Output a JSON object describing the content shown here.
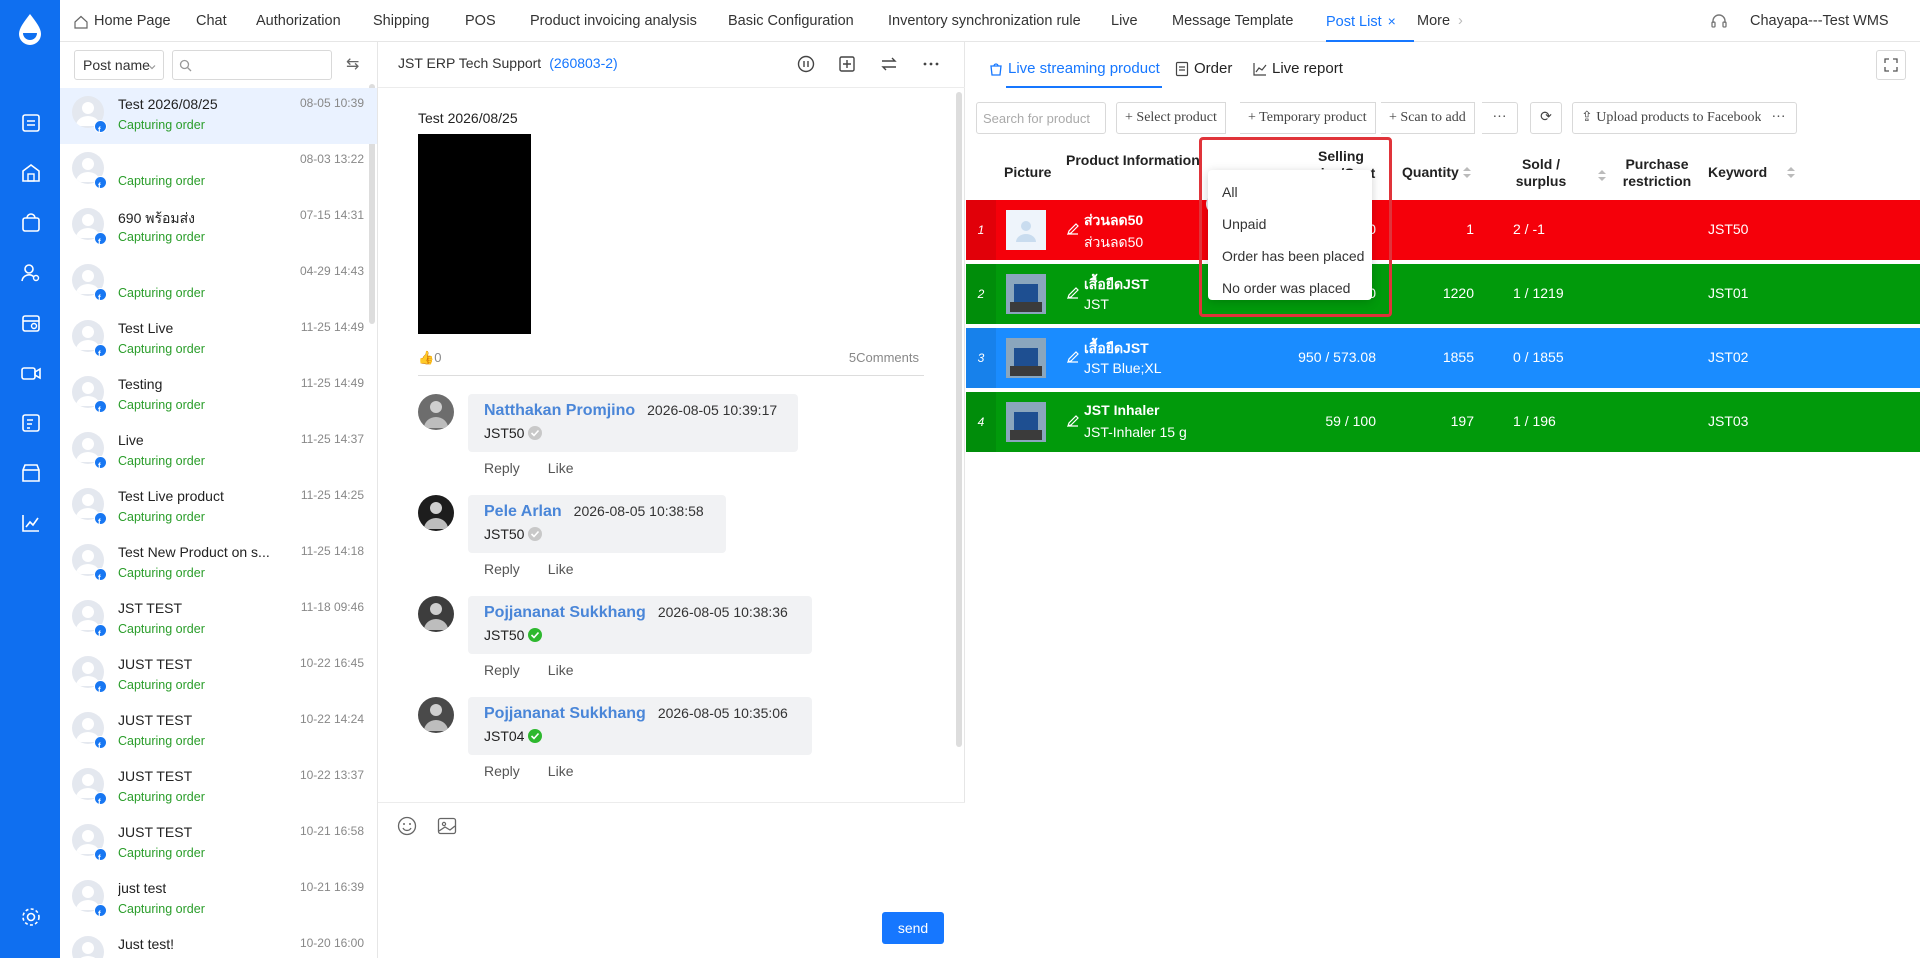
{
  "topnav": {
    "tabs": [
      "Home Page",
      "Chat",
      "Authorization",
      "Shipping",
      "POS",
      "Product invoicing analysis",
      "Basic Configuration",
      "Inventory synchronization rule",
      "Live",
      "Message Template",
      "Post List",
      "More"
    ],
    "active_index": 10,
    "user": "Chayapa---Test WMS"
  },
  "posts": {
    "filter_label": "Post name",
    "search_placeholder": "",
    "items": [
      {
        "name": "Test 2026/08/25",
        "status": "Capturing order",
        "time": "08-05 10:39"
      },
      {
        "name": "",
        "status": "Capturing order",
        "time": "08-03 13:22"
      },
      {
        "name": "690 พร้อมส่ง",
        "status": "Capturing order",
        "time": "07-15 14:31"
      },
      {
        "name": "",
        "status": "Capturing order",
        "time": "04-29 14:43"
      },
      {
        "name": "Test Live",
        "status": "Capturing order",
        "time": "11-25 14:49"
      },
      {
        "name": "Testing",
        "status": "Capturing order",
        "time": "11-25 14:49"
      },
      {
        "name": "Live",
        "status": "Capturing order",
        "time": "11-25 14:37"
      },
      {
        "name": "Test Live product",
        "status": "Capturing order",
        "time": "11-25 14:25"
      },
      {
        "name": "Test New Product on s...",
        "status": "Capturing order",
        "time": "11-25 14:18"
      },
      {
        "name": "JST TEST",
        "status": "Capturing order",
        "time": "11-18 09:46"
      },
      {
        "name": "JUST TEST",
        "status": "Capturing order",
        "time": "10-22 16:45"
      },
      {
        "name": "JUST TEST",
        "status": "Capturing order",
        "time": "10-22 14:24"
      },
      {
        "name": "JUST TEST",
        "status": "Capturing order",
        "time": "10-22 13:37"
      },
      {
        "name": "JUST TEST",
        "status": "Capturing order",
        "time": "10-21 16:58"
      },
      {
        "name": "just test",
        "status": "Capturing order",
        "time": "10-21 16:39"
      },
      {
        "name": "Just test!",
        "status": "",
        "time": "10-20 16:00"
      }
    ]
  },
  "comments": {
    "page_title": "JST ERP Tech Support",
    "page_id": "(260803-2)",
    "post_title": "Test 2026/08/25",
    "likes": "0",
    "comment_count": "5Comments",
    "items": [
      {
        "author": "Natthakan Promjino",
        "time": "2026-08-05 10:39:17",
        "text": "JST50",
        "ok": false
      },
      {
        "author": "Pele Arlan",
        "time": "2026-08-05 10:38:58",
        "text": "JST50",
        "ok": false
      },
      {
        "author": "Pojjananat Sukkhang",
        "time": "2026-08-05 10:38:36",
        "text": "JST50",
        "ok": true
      },
      {
        "author": "Pojjananat Sukkhang",
        "time": "2026-08-05 10:35:06",
        "text": "JST04",
        "ok": true
      }
    ],
    "reply_label": "Reply",
    "like_label": "Like",
    "send_label": "send"
  },
  "right": {
    "tabs": [
      "Live streaming product",
      "Order",
      "Live report"
    ],
    "search_placeholder": "Search for product",
    "toolbar": [
      "Select product",
      "Temporary product",
      "Scan to add",
      "···",
      "Upload products to Facebook",
      "···"
    ],
    "columns": {
      "picture": "Picture",
      "product_info": "Product Information",
      "price": "Selling price/Cost price",
      "quantity": "Quantity",
      "sold": "Sold / surplus",
      "purchase": "Purchase restriction",
      "keyword": "Keyword"
    },
    "rows": [
      {
        "idx": "1",
        "name": "ส่วนลด50",
        "sub": "ส่วนลด50",
        "price": "- / 0",
        "qty": "1",
        "sold": "2 / -1",
        "keyword": "JST50",
        "color": "#f5000a"
      },
      {
        "idx": "2",
        "name": "เสื้อยืดJST",
        "sub": "JST",
        "price": "- / 500",
        "qty": "1220",
        "sold": "1 / 1219",
        "keyword": "JST01",
        "color": "#019a0b"
      },
      {
        "idx": "3",
        "name": "เสื้อยืดJST",
        "sub": "JST   Blue;XL",
        "price": "950 / 573.08",
        "qty": "1855",
        "sold": "0 / 1855",
        "keyword": "JST02",
        "color": "#1a8cff"
      },
      {
        "idx": "4",
        "name": "JST Inhaler",
        "sub": "JST-Inhaler   15 g",
        "price": "59 / 100",
        "qty": "197",
        "sold": "1 / 196",
        "keyword": "JST03",
        "color": "#019a0b"
      }
    ],
    "filter_options": [
      "All",
      "Unpaid",
      "Order has been placed",
      "No order was placed"
    ]
  }
}
